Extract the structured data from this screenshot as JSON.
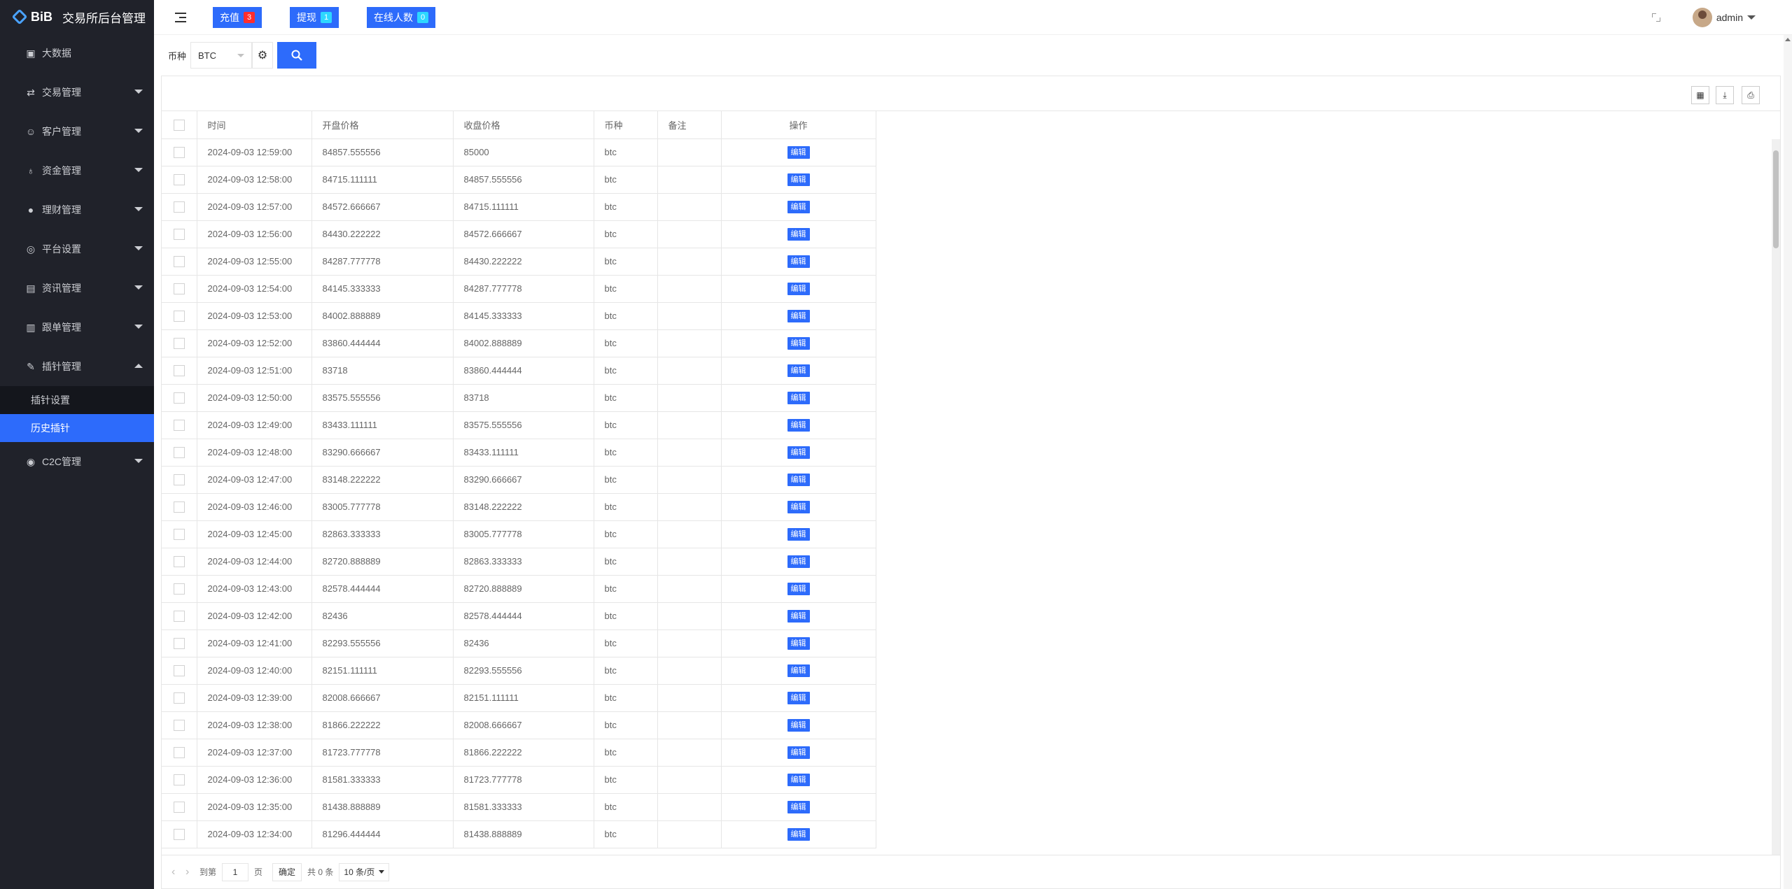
{
  "app": {
    "logo_text": "BiB",
    "title": "交易所后台管理"
  },
  "sidebar": {
    "items": [
      {
        "label": "大数据",
        "icon": "chart-icon",
        "has_caret": false
      },
      {
        "label": "交易管理",
        "icon": "swap-icon",
        "has_caret": true
      },
      {
        "label": "客户管理",
        "icon": "users-icon",
        "has_caret": true
      },
      {
        "label": "资金管理",
        "icon": "money-bag-icon",
        "has_caret": true
      },
      {
        "label": "理财管理",
        "icon": "piggy-bank-icon",
        "has_caret": true
      },
      {
        "label": "平台设置",
        "icon": "target-icon",
        "has_caret": true
      },
      {
        "label": "资讯管理",
        "icon": "news-icon",
        "has_caret": true
      },
      {
        "label": "跟单管理",
        "icon": "document-icon",
        "has_caret": true
      },
      {
        "label": "插针管理",
        "icon": "pin-icon",
        "has_caret": true,
        "expanded": true
      },
      {
        "label": "C2C管理",
        "icon": "circle-icon",
        "has_caret": true
      }
    ],
    "submenu": [
      {
        "label": "插针设置",
        "active": false
      },
      {
        "label": "历史插针",
        "active": true
      }
    ]
  },
  "header": {
    "buttons": [
      {
        "label": "充值",
        "badge": "3",
        "badge_color": "#ff2d2d"
      },
      {
        "label": "提现",
        "badge": "1",
        "badge_color": "#2dd7ff"
      },
      {
        "label": "在线人数",
        "badge": "0",
        "badge_color": "#2dd7ff"
      }
    ],
    "user": "admin"
  },
  "filter": {
    "label": "币种",
    "selected": "BTC"
  },
  "table": {
    "columns": [
      "时间",
      "开盘价格",
      "收盘价格",
      "币种",
      "备注",
      "操作"
    ],
    "edit_label": "编辑",
    "rows": [
      [
        "2024-09-03 12:59:00",
        "84857.555556",
        "85000",
        "btc",
        ""
      ],
      [
        "2024-09-03 12:58:00",
        "84715.111111",
        "84857.555556",
        "btc",
        ""
      ],
      [
        "2024-09-03 12:57:00",
        "84572.666667",
        "84715.111111",
        "btc",
        ""
      ],
      [
        "2024-09-03 12:56:00",
        "84430.222222",
        "84572.666667",
        "btc",
        ""
      ],
      [
        "2024-09-03 12:55:00",
        "84287.777778",
        "84430.222222",
        "btc",
        ""
      ],
      [
        "2024-09-03 12:54:00",
        "84145.333333",
        "84287.777778",
        "btc",
        ""
      ],
      [
        "2024-09-03 12:53:00",
        "84002.888889",
        "84145.333333",
        "btc",
        ""
      ],
      [
        "2024-09-03 12:52:00",
        "83860.444444",
        "84002.888889",
        "btc",
        ""
      ],
      [
        "2024-09-03 12:51:00",
        "83718",
        "83860.444444",
        "btc",
        ""
      ],
      [
        "2024-09-03 12:50:00",
        "83575.555556",
        "83718",
        "btc",
        ""
      ],
      [
        "2024-09-03 12:49:00",
        "83433.111111",
        "83575.555556",
        "btc",
        ""
      ],
      [
        "2024-09-03 12:48:00",
        "83290.666667",
        "83433.111111",
        "btc",
        ""
      ],
      [
        "2024-09-03 12:47:00",
        "83148.222222",
        "83290.666667",
        "btc",
        ""
      ],
      [
        "2024-09-03 12:46:00",
        "83005.777778",
        "83148.222222",
        "btc",
        ""
      ],
      [
        "2024-09-03 12:45:00",
        "82863.333333",
        "83005.777778",
        "btc",
        ""
      ],
      [
        "2024-09-03 12:44:00",
        "82720.888889",
        "82863.333333",
        "btc",
        ""
      ],
      [
        "2024-09-03 12:43:00",
        "82578.444444",
        "82720.888889",
        "btc",
        ""
      ],
      [
        "2024-09-03 12:42:00",
        "82436",
        "82578.444444",
        "btc",
        ""
      ],
      [
        "2024-09-03 12:41:00",
        "82293.555556",
        "82436",
        "btc",
        ""
      ],
      [
        "2024-09-03 12:40:00",
        "82151.111111",
        "82293.555556",
        "btc",
        ""
      ],
      [
        "2024-09-03 12:39:00",
        "82008.666667",
        "82151.111111",
        "btc",
        ""
      ],
      [
        "2024-09-03 12:38:00",
        "81866.222222",
        "82008.666667",
        "btc",
        ""
      ],
      [
        "2024-09-03 12:37:00",
        "81723.777778",
        "81866.222222",
        "btc",
        ""
      ],
      [
        "2024-09-03 12:36:00",
        "81581.333333",
        "81723.777778",
        "btc",
        ""
      ],
      [
        "2024-09-03 12:35:00",
        "81438.888889",
        "81581.333333",
        "btc",
        ""
      ],
      [
        "2024-09-03 12:34:00",
        "81296.444444",
        "81438.888889",
        "btc",
        ""
      ]
    ]
  },
  "pager": {
    "goto_label": "到第",
    "page_value": "1",
    "page_unit": "页",
    "confirm_label": "确定",
    "total_label": "共 0 条",
    "page_size": "10 条/页"
  }
}
